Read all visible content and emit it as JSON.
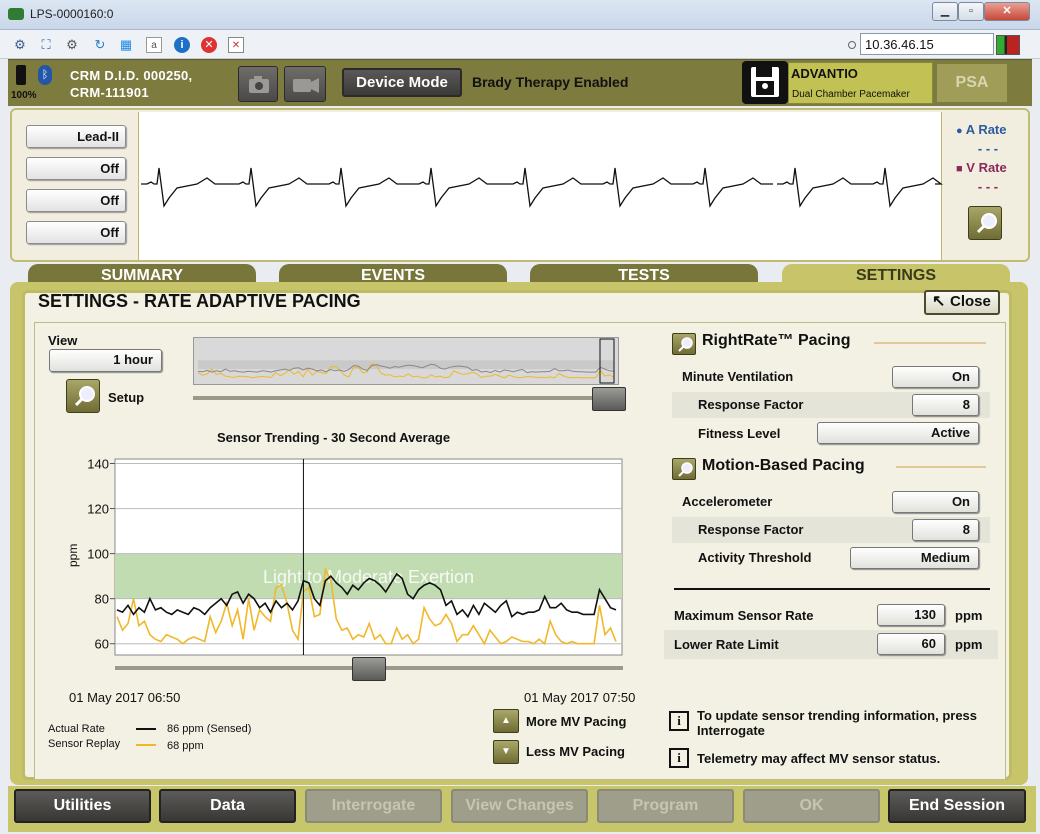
{
  "window": {
    "title": "LPS-0000160:0",
    "ip_address": "10.36.46.15"
  },
  "header": {
    "battery": "100%",
    "crm_line1": "CRM D.I.D. 000250,",
    "crm_line2": "CRM-111901",
    "device_mode_label": "Device Mode",
    "therapy_status": "Brady Therapy Enabled",
    "device_name": "ADVANTIO",
    "device_type": "Dual Chamber Pacemaker",
    "psa_label": "PSA"
  },
  "ecg": {
    "leads": [
      "Lead-II",
      "Off",
      "Off",
      "Off"
    ],
    "a_rate_label": "A Rate",
    "a_rate_value": "- - -",
    "v_rate_label": "V Rate",
    "v_rate_value": "- - -"
  },
  "tabs": [
    {
      "label": "SUMMARY"
    },
    {
      "label": "EVENTS"
    },
    {
      "label": "TESTS"
    },
    {
      "label": "SETTINGS"
    }
  ],
  "settings": {
    "title": "SETTINGS - RATE ADAPTIVE PACING",
    "close_label": "Close",
    "view_label": "View",
    "view_value": "1 hour",
    "setup_label": "Setup",
    "chart_title": "Sensor Trending - 30 Second Average",
    "start_time": "01 May 2017 06:50",
    "end_time": "01 May 2017 07:50",
    "legend": [
      {
        "name": "Actual Rate",
        "value": "86 ppm (Sensed)",
        "color": "#111111"
      },
      {
        "name": "Sensor Replay",
        "value": "68 ppm",
        "color": "#f0b82a"
      }
    ],
    "more_mv": "More MV Pacing",
    "less_mv": "Less MV Pacing",
    "rightrate": {
      "title": "RightRate™ Pacing",
      "minute_ventilation_label": "Minute Ventilation",
      "minute_ventilation_value": "On",
      "response_factor_label": "Response Factor",
      "response_factor_value": "8",
      "fitness_level_label": "Fitness Level",
      "fitness_level_value": "Active"
    },
    "motion": {
      "title": "Motion-Based Pacing",
      "accelerometer_label": "Accelerometer",
      "accelerometer_value": "On",
      "response_factor_label": "Response Factor",
      "response_factor_value": "8",
      "activity_threshold_label": "Activity Threshold",
      "activity_threshold_value": "Medium"
    },
    "max_sensor_rate_label": "Maximum Sensor Rate",
    "max_sensor_rate_value": "130",
    "lower_rate_limit_label": "Lower Rate Limit",
    "lower_rate_limit_value": "60",
    "ppm": "ppm",
    "info1": "To update sensor trending information, press Interrogate",
    "info2": "Telemetry may affect MV sensor status."
  },
  "bottom": {
    "buttons": [
      {
        "label": "Utilities",
        "enabled": true
      },
      {
        "label": "Data",
        "enabled": true
      },
      {
        "label": "Interrogate",
        "enabled": false
      },
      {
        "label": "View Changes",
        "enabled": false
      },
      {
        "label": "Program",
        "enabled": false
      },
      {
        "label": "OK",
        "enabled": false
      },
      {
        "label": "End Session",
        "enabled": true
      }
    ]
  },
  "chart_data": {
    "type": "line",
    "title": "Sensor Trending - 30 Second Average",
    "ylabel": "ppm",
    "ylim": [
      55,
      142
    ],
    "yticks": [
      60,
      80,
      100,
      120,
      140
    ],
    "x_start": "01 May 2017 06:50",
    "x_end": "01 May 2017 07:50",
    "band": {
      "from": 80,
      "to": 100,
      "label": "Light to Moderate Exertion",
      "color": "#c0dcb0"
    },
    "cursor_index": 34,
    "series": [
      {
        "name": "Actual Rate",
        "color": "#111111",
        "values": [
          75,
          74,
          77,
          73,
          76,
          74,
          80,
          75,
          76,
          74,
          73,
          75,
          74,
          73,
          76,
          75,
          73,
          76,
          78,
          80,
          77,
          82,
          83,
          78,
          82,
          80,
          76,
          78,
          74,
          79,
          76,
          78,
          75,
          79,
          88,
          87,
          80,
          77,
          88,
          90,
          87,
          85,
          82,
          86,
          84,
          87,
          89,
          88,
          86,
          83,
          87,
          91,
          89,
          82,
          80,
          84,
          86,
          87,
          86,
          84,
          77,
          79,
          73,
          75,
          72,
          77,
          73,
          78,
          76,
          74,
          77,
          79,
          72,
          74,
          73,
          74,
          74,
          75,
          81,
          76,
          76,
          78,
          75,
          74,
          74,
          73,
          73,
          73,
          84,
          80,
          76,
          75
        ]
      },
      {
        "name": "Sensor Replay",
        "color": "#f0b82a",
        "values": [
          72,
          66,
          69,
          80,
          68,
          70,
          64,
          62,
          61,
          64,
          63,
          62,
          60,
          62,
          63,
          62,
          61,
          72,
          65,
          70,
          78,
          68,
          75,
          62,
          80,
          66,
          75,
          72,
          70,
          85,
          86,
          78,
          66,
          62,
          83,
          85,
          72,
          73,
          93,
          88,
          71,
          66,
          67,
          62,
          64,
          63,
          69,
          62,
          64,
          60,
          60,
          67,
          62,
          64,
          60,
          62,
          76,
          71,
          68,
          69,
          73,
          69,
          61,
          64,
          64,
          68,
          64,
          60,
          66,
          63,
          60,
          61,
          63,
          62,
          61,
          61,
          60,
          62,
          60,
          70,
          64,
          61,
          60,
          61,
          60,
          60,
          60,
          60,
          77,
          64,
          67,
          61
        ]
      }
    ]
  }
}
